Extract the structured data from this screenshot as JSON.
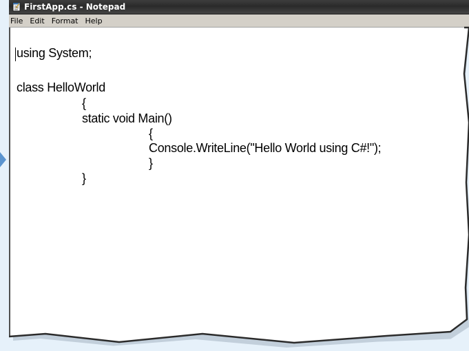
{
  "window": {
    "title": "FirstApp.cs - Notepad"
  },
  "menubar": {
    "items": [
      "File",
      "Edit",
      "Format",
      "Help"
    ]
  },
  "editor": {
    "lines": [
      "using System;",
      "",
      "class HelloWorld",
      "{",
      "static void Main()",
      "{",
      "Console.WriteLine(\"Hello World using C#!\");",
      "}",
      "}"
    ]
  },
  "icons": {
    "app_icon": "notepad-icon",
    "side_marker": "arrow-right-icon"
  }
}
